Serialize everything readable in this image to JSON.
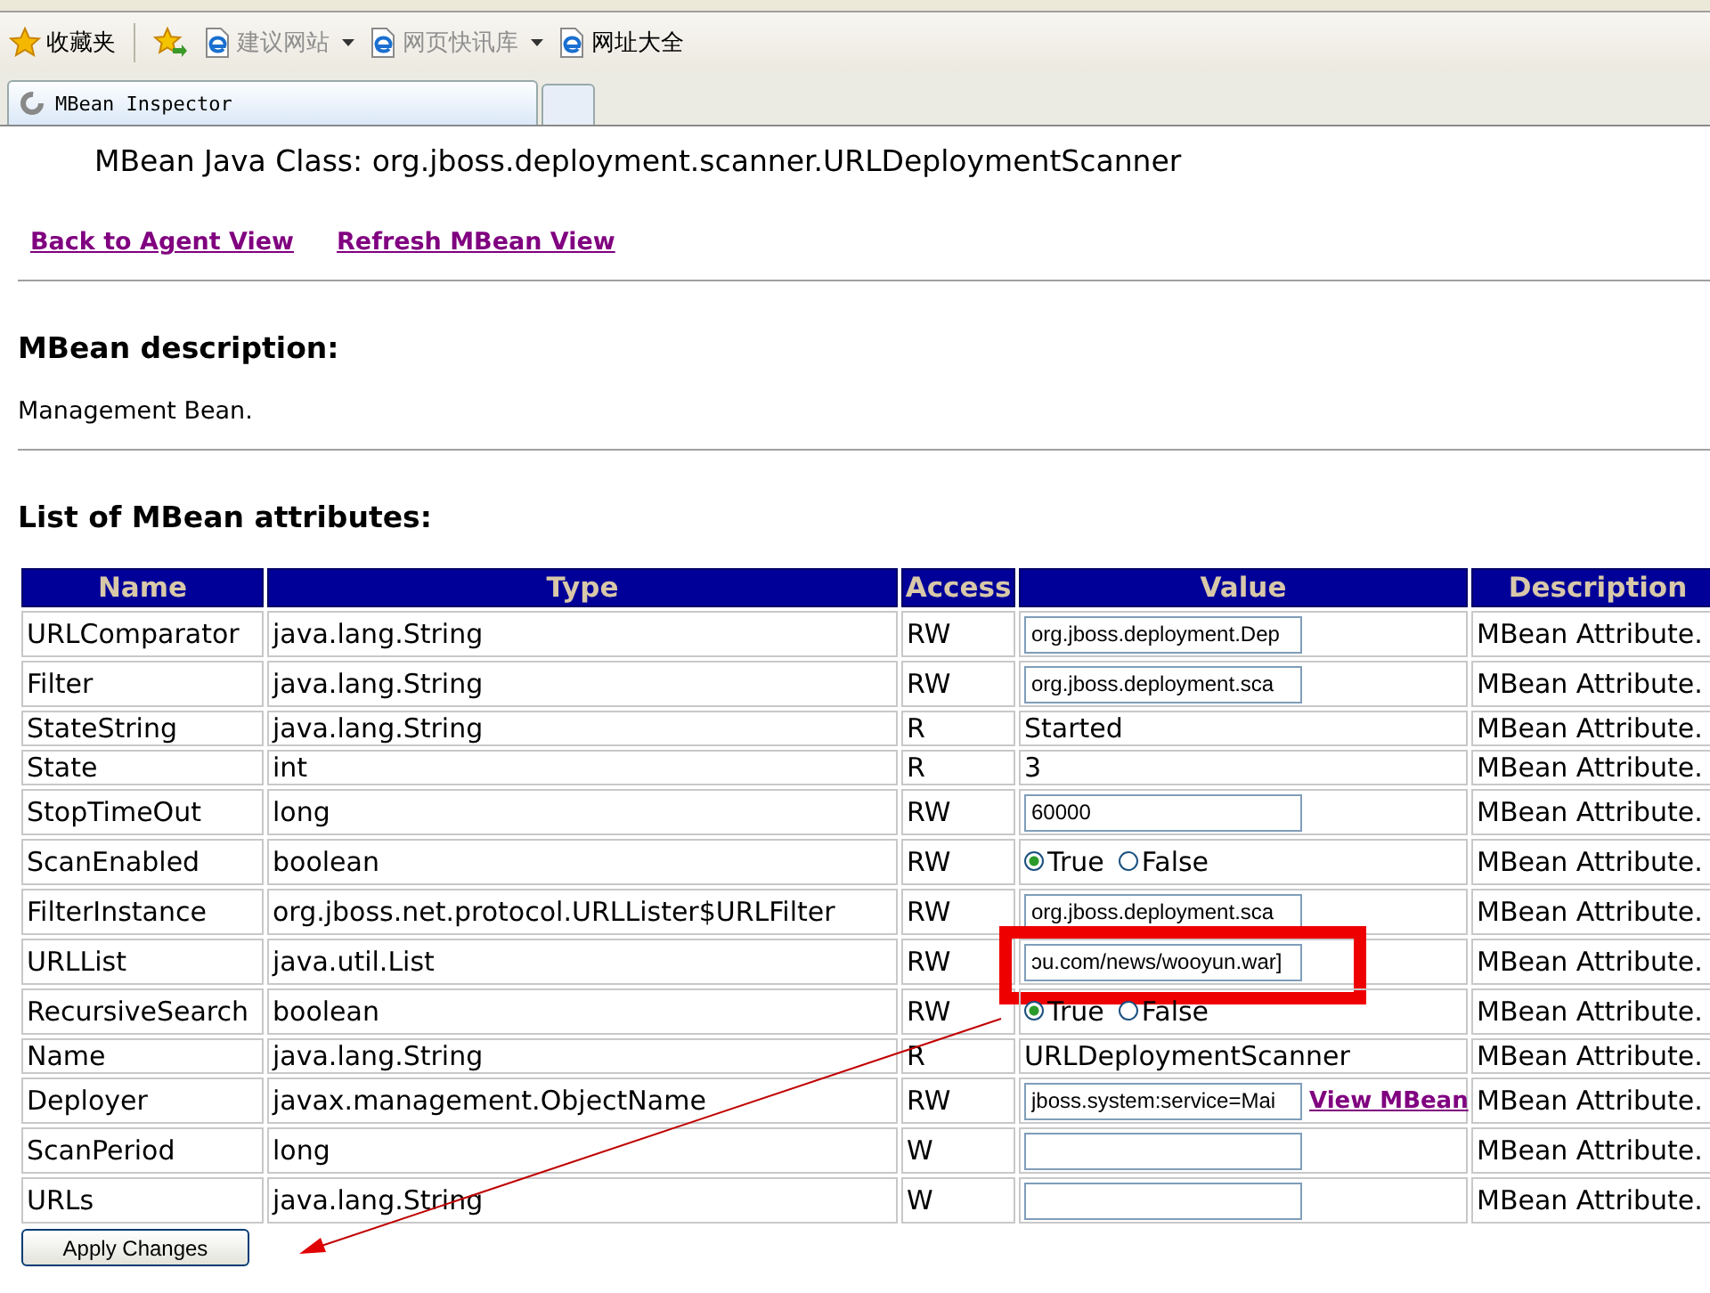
{
  "browser": {
    "favorites_bar": {
      "title": "收藏夹",
      "links": [
        {
          "label": "建议网站",
          "dropdown": true,
          "disabled": true
        },
        {
          "label": "网页快讯库",
          "dropdown": true,
          "disabled": true
        },
        {
          "label": "网址大全",
          "dropdown": false,
          "disabled": false
        }
      ]
    },
    "tabs": [
      {
        "title": "MBean Inspector",
        "selected": true
      }
    ]
  },
  "page": {
    "class_line": "MBean Java Class: org.jboss.deployment.scanner.URLDeploymentScanner",
    "links": [
      "Back to Agent View",
      "Refresh MBean View"
    ],
    "description_heading": "MBean description:",
    "description": "Management Bean.",
    "attributes_heading": "List of MBean attributes:"
  },
  "table": {
    "columns": [
      "Name",
      "Type",
      "Access",
      "Value",
      "Description"
    ],
    "rows": [
      {
        "name": "URLComparator",
        "type": "java.lang.String",
        "access": "RW",
        "value": {
          "kind": "input",
          "text": "org.jboss.deployment.Dep"
        },
        "description": "MBean Attribute.",
        "highlighted": false
      },
      {
        "name": "Filter",
        "type": "java.lang.String",
        "access": "RW",
        "value": {
          "kind": "input",
          "text": "org.jboss.deployment.sca"
        },
        "description": "MBean Attribute.",
        "highlighted": false
      },
      {
        "name": "StateString",
        "type": "java.lang.String",
        "access": "R",
        "value": {
          "kind": "text",
          "text": "Started"
        },
        "description": "MBean Attribute.",
        "highlighted": false
      },
      {
        "name": "State",
        "type": "int",
        "access": "R",
        "value": {
          "kind": "text",
          "text": "3"
        },
        "description": "MBean Attribute.",
        "highlighted": false
      },
      {
        "name": "StopTimeOut",
        "type": "long",
        "access": "RW",
        "value": {
          "kind": "input",
          "text": "60000"
        },
        "description": "MBean Attribute.",
        "highlighted": false
      },
      {
        "name": "ScanEnabled",
        "type": "boolean",
        "access": "RW",
        "value": {
          "kind": "radio",
          "options": [
            {
              "label": "True",
              "selected": true
            },
            {
              "label": "False",
              "selected": false
            }
          ]
        },
        "description": "MBean Attribute.",
        "highlighted": false
      },
      {
        "name": "FilterInstance",
        "type": "org.jboss.net.protocol.URLLister$URLFilter",
        "access": "RW",
        "value": {
          "kind": "input",
          "text": "org.jboss.deployment.sca"
        },
        "description": "MBean Attribute.",
        "highlighted": false
      },
      {
        "name": "URLList",
        "type": "java.util.List",
        "access": "RW",
        "value": {
          "kind": "input",
          "text": "ɔu.com/news/wooyun.war]"
        },
        "description": "MBean Attribute.",
        "highlighted": true
      },
      {
        "name": "RecursiveSearch",
        "type": "boolean",
        "access": "RW",
        "value": {
          "kind": "radio",
          "options": [
            {
              "label": "True",
              "selected": true
            },
            {
              "label": "False",
              "selected": false
            }
          ]
        },
        "description": "MBean Attribute.",
        "highlighted": false
      },
      {
        "name": "Name",
        "type": "java.lang.String",
        "access": "R",
        "value": {
          "kind": "text",
          "text": "URLDeploymentScanner"
        },
        "description": "MBean Attribute.",
        "highlighted": false
      },
      {
        "name": "Deployer",
        "type": "javax.management.ObjectName",
        "access": "RW",
        "value": {
          "kind": "input_link",
          "text": "jboss.system:service=Mai",
          "link": "View MBean"
        },
        "description": "MBean Attribute.",
        "highlighted": false
      },
      {
        "name": "ScanPeriod",
        "type": "long",
        "access": "W",
        "value": {
          "kind": "input"
        },
        "description": "MBean Attribute.",
        "highlighted": false
      },
      {
        "name": "URLs",
        "type": "java.lang.String",
        "access": "W",
        "value": {
          "kind": "input"
        },
        "description": "MBean Attribute.",
        "highlighted": false
      }
    ]
  },
  "apply_button": "Apply Changes"
}
